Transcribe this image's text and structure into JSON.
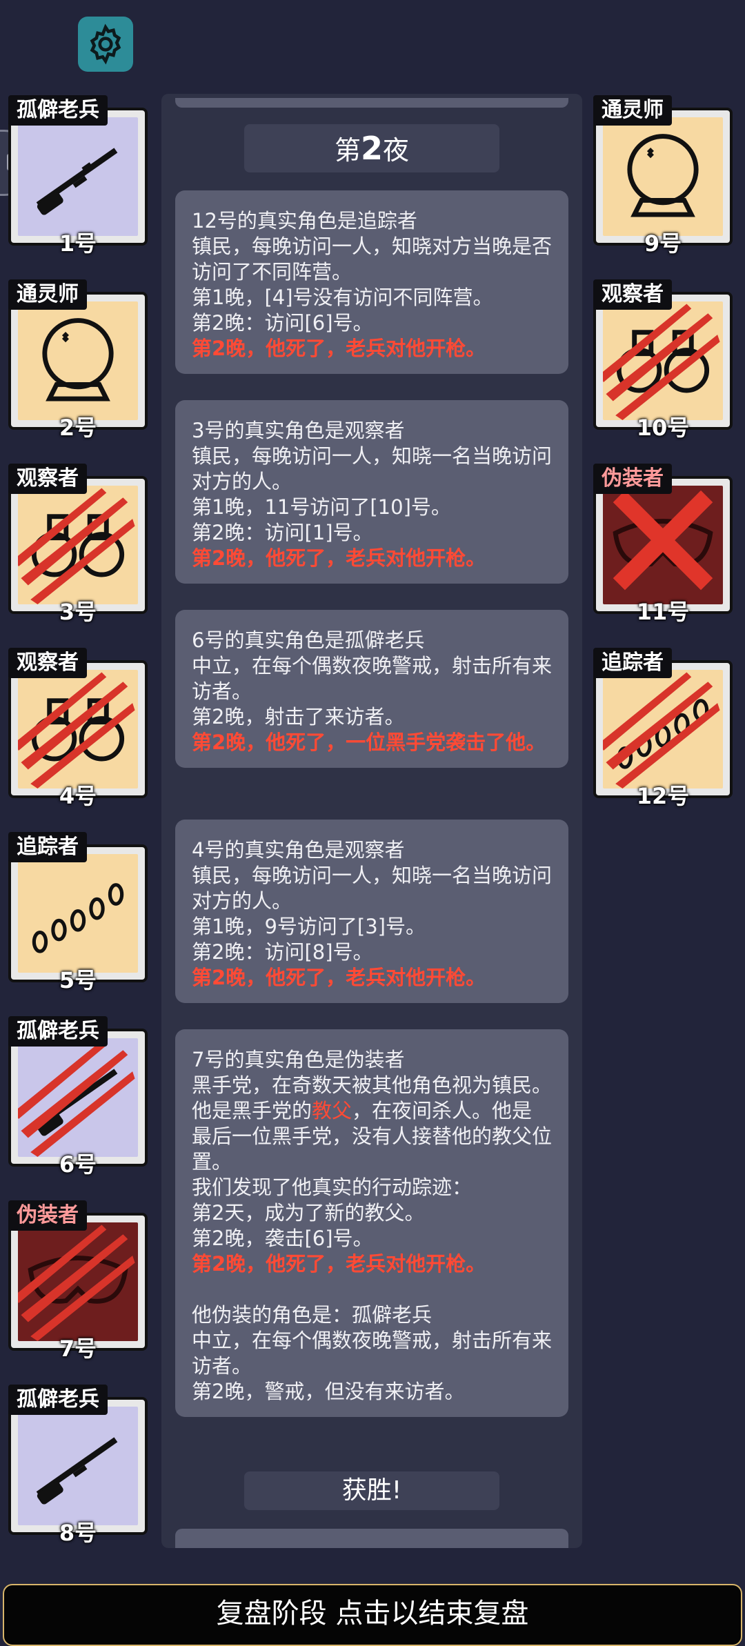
{
  "phase_bar": "复盘阶段 点击以结束复盘",
  "log": {
    "night_prefix": "第",
    "night_number": "2",
    "night_suffix": "夜",
    "victory": "获胜!",
    "entries": [
      {
        "lines": [
          "12号的真实角色是追踪者",
          "镇民，每晚访问一人，知晓对方当晚是否访问了不同阵营。",
          "第1晚，[4]号没有访问不同阵营。",
          "第2晚：访问[6]号。"
        ],
        "death": "第2晚，他死了，老兵对他开枪。"
      },
      {
        "lines": [
          "3号的真实角色是观察者",
          "镇民，每晚访问一人，知晓一名当晚访问对方的人。",
          "第1晚，11号访问了[10]号。",
          "第2晚：访问[1]号。"
        ],
        "death": "第2晚，他死了，老兵对他开枪。"
      },
      {
        "lines": [
          "6号的真实角色是孤僻老兵",
          "中立，在每个偶数夜晚警戒，射击所有来访者。",
          "第2晚，射击了来访者。"
        ],
        "death": "第2晚，他死了，一位黑手党袭击了他。"
      },
      {
        "lines": [
          "4号的真实角色是观察者",
          "镇民，每晚访问一人，知晓一名当晚访问对方的人。",
          "第1晚，9号访问了[3]号。",
          "第2晚：访问[8]号。"
        ],
        "death": "第2晚，他死了，老兵对他开枪。"
      }
    ],
    "entry5": {
      "l1": "7号的真实角色是伪装者",
      "l2": "黑手党，在奇数天被其他角色视为镇民。",
      "l3a": "他是黑手党的",
      "l3b": "教父",
      "l3c": "，在夜间杀人。他是最后一位黑手党，没有人接替他的教父位置。",
      "l4": "我们发现了他真实的行动踪迹：",
      "l5": "第2天，成为了新的教父。",
      "l6": "第2晚，袭击[6]号。",
      "death": "第2晚，他死了，老兵对他开枪。",
      "l7": "他伪装的角色是：孤僻老兵",
      "l8": "中立，在每个偶数夜晚警戒，射击所有来访者。",
      "l9": "第2晚，警戒，但没有来访者。"
    }
  },
  "players": [
    {
      "num": "1号",
      "role": "孤僻老兵",
      "icon": "rifle-icon",
      "bg": "#c9c6ea",
      "dead": false
    },
    {
      "num": "2号",
      "role": "通灵师",
      "icon": "crystal-ball-icon",
      "bg": "#f7d9a2",
      "dead": false
    },
    {
      "num": "3号",
      "role": "观察者",
      "icon": "binoculars-icon",
      "bg": "#f7d9a2",
      "dead": true
    },
    {
      "num": "4号",
      "role": "观察者",
      "icon": "binoculars-icon",
      "bg": "#f7d9a2",
      "dead": true
    },
    {
      "num": "5号",
      "role": "追踪者",
      "icon": "footprints-icon",
      "bg": "#f7d9a2",
      "dead": false
    },
    {
      "num": "6号",
      "role": "孤僻老兵",
      "icon": "rifle-icon",
      "bg": "#c9c6ea",
      "dead": true
    },
    {
      "num": "7号",
      "role": "伪装者",
      "icon": "mask-icon",
      "bg": "#6e1e1e",
      "dead": true
    },
    {
      "num": "8号",
      "role": "孤僻老兵",
      "icon": "rifle-icon",
      "bg": "#c9c6ea",
      "dead": false
    },
    {
      "num": "9号",
      "role": "通灵师",
      "icon": "crystal-ball-icon",
      "bg": "#f7d9a2",
      "dead": false
    },
    {
      "num": "10号",
      "role": "观察者",
      "icon": "binoculars-icon",
      "bg": "#f7d9a2",
      "dead": true
    },
    {
      "num": "11号",
      "role": "伪装者",
      "icon": "mask-icon",
      "bg": "#6e1e1e",
      "dead": true
    },
    {
      "num": "12号",
      "role": "追踪者",
      "icon": "footprints-icon",
      "bg": "#f7d9a2",
      "dead": true
    }
  ]
}
